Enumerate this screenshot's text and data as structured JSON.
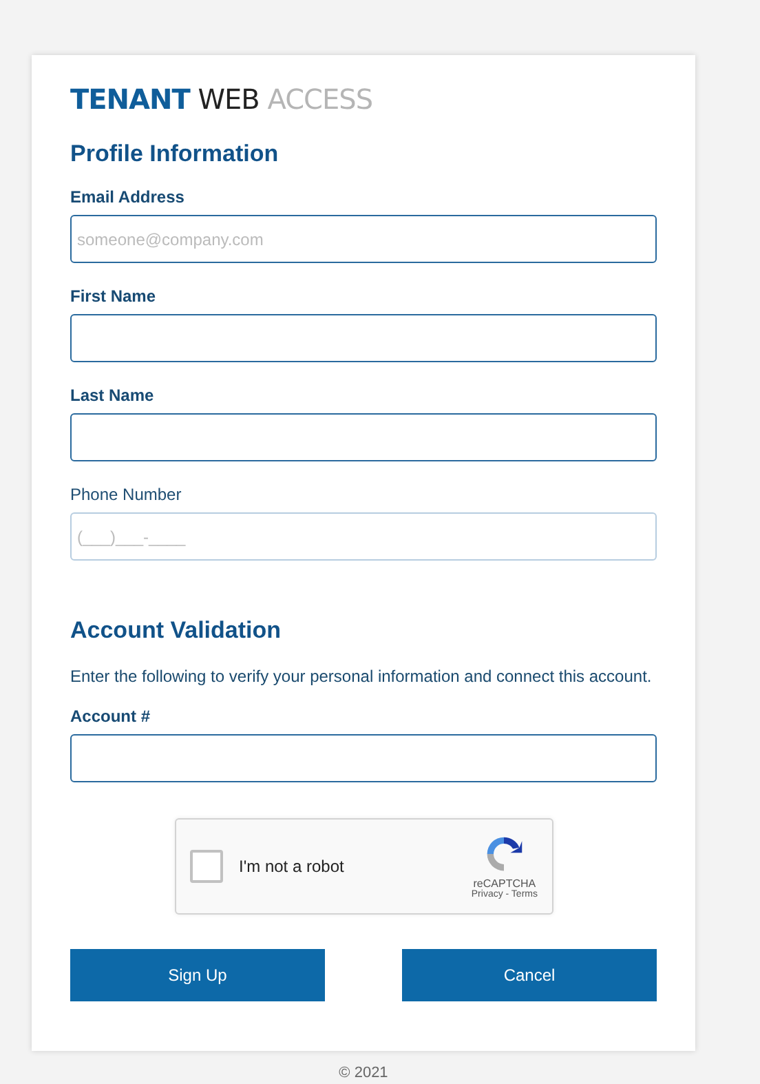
{
  "logo": {
    "parts": [
      {
        "text": "TENANT",
        "kind": "strong"
      },
      {
        "text": "WEB",
        "kind": "dark"
      },
      {
        "text": "ACCESS",
        "kind": "light"
      }
    ]
  },
  "sections": [
    {
      "title": "Profile Information",
      "fields": [
        {
          "label": "Email Address",
          "placeholder": "someone@company.com",
          "required": true
        },
        {
          "label": "First Name",
          "required": true
        },
        {
          "label": "Last Name",
          "required": true
        },
        {
          "label": "Phone Number",
          "placeholder": "(___)___-____",
          "required": false
        }
      ]
    },
    {
      "title": "Account Validation",
      "description": "Enter the following to verify your personal information and connect this account.",
      "fields": [
        {
          "label": "Account #",
          "required": true
        }
      ]
    }
  ],
  "captcha": {
    "label": "I'm not a robot",
    "checked": false,
    "brand": "reCAPTCHA",
    "links": "Privacy - Terms"
  },
  "buttons": [
    "Sign Up",
    "Cancel"
  ],
  "footer": "© 2021"
}
